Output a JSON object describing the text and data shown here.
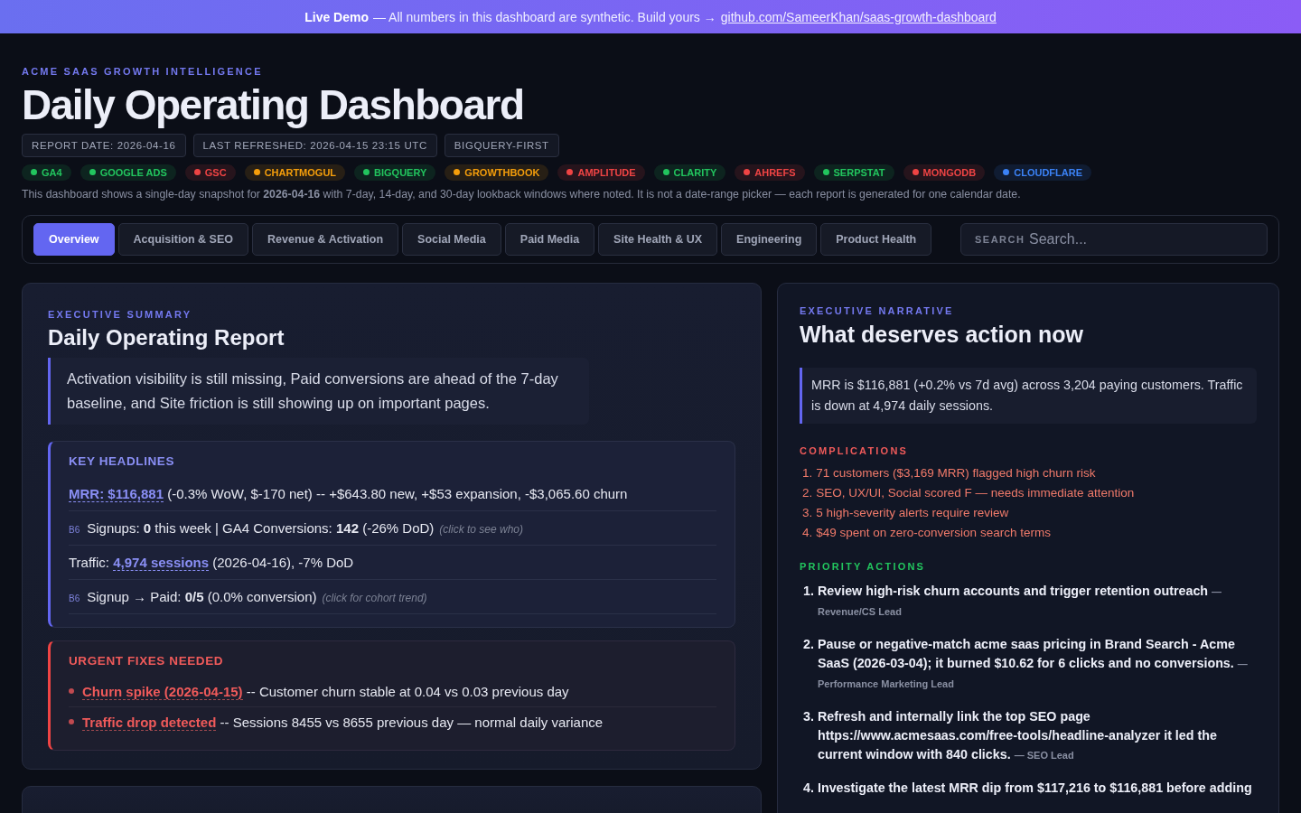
{
  "banner": {
    "label": "Live Demo",
    "text": "— All numbers in this dashboard are synthetic. Build yours →",
    "link": "github.com/SameerKhan/saas-growth-dashboard"
  },
  "header": {
    "eyebrow": "ACME SAAS GROWTH INTELLIGENCE",
    "title": "Daily Operating Dashboard",
    "meta": [
      "REPORT DATE: 2026-04-16",
      "LAST REFRESHED: 2026-04-15 23:15 UTC",
      "BIGQUERY-FIRST"
    ],
    "sources": [
      {
        "label": "GA4",
        "color": "#22c55e"
      },
      {
        "label": "GOOGLE ADS",
        "color": "#22c55e"
      },
      {
        "label": "GSC",
        "color": "#ef4444"
      },
      {
        "label": "CHARTMOGUL",
        "color": "#f59e0b"
      },
      {
        "label": "BIGQUERY",
        "color": "#22c55e"
      },
      {
        "label": "GROWTHBOOK",
        "color": "#f59e0b"
      },
      {
        "label": "AMPLITUDE",
        "color": "#ef4444"
      },
      {
        "label": "CLARITY",
        "color": "#22c55e"
      },
      {
        "label": "AHREFS",
        "color": "#ef4444"
      },
      {
        "label": "SERPSTAT",
        "color": "#22c55e"
      },
      {
        "label": "MONGODB",
        "color": "#ef4444"
      },
      {
        "label": "CLOUDFLARE",
        "color": "#3b82f6"
      }
    ],
    "note": "This dashboard shows a single-day snapshot for **2026-04-16** with 7-day, 14-day, and 30-day lookback windows where noted. It is not a date-range picker — each report is generated for one calendar date."
  },
  "tabs": [
    {
      "label": "Overview",
      "selected": true
    },
    {
      "label": "Acquisition & SEO",
      "selected": false
    },
    {
      "label": "Revenue & Activation",
      "selected": false
    },
    {
      "label": "Social Media",
      "selected": false
    },
    {
      "label": "Paid Media",
      "selected": false
    },
    {
      "label": "Site Health & UX",
      "selected": false
    },
    {
      "label": "Engineering",
      "selected": false
    },
    {
      "label": "Product Health",
      "selected": false
    }
  ],
  "search": {
    "label": "SEARCH",
    "placeholder": "Search..."
  },
  "summary": {
    "eyebrow": "EXECUTIVE SUMMARY",
    "title": "Daily Operating Report",
    "lead": "Activation visibility is still missing, Paid conversions are ahead of the 7-day baseline, and Site friction is still showing up on important pages.",
    "headlines": {
      "title": "KEY HEADLINES",
      "items": [
        {
          "link": "MRR: $116,881",
          "text": "(-0.3% WoW, $-170 net) -- +$643.80 new, +$53 expansion, -$3,065.60 churn"
        },
        {
          "badge": "B6",
          "text": "Signups: **0** this week | GA4 Conversions: **142** (-26% DoD)",
          "hint": "(click to see who)"
        },
        {
          "prefix": "Traffic:",
          "link": "4,974 sessions",
          "text": "(2026-04-16), -7% DoD"
        },
        {
          "badge": "B6",
          "text": "Signup → Paid: **0/5** (0.0% conversion)",
          "hint": "(click for cohort trend)"
        }
      ]
    },
    "urgent": {
      "title": "URGENT FIXES NEEDED",
      "items": [
        {
          "link": "Churn spike (2026-04-15)",
          "text": "-- Customer churn stable at 0.04 vs 0.03 previous day"
        },
        {
          "link": "Traffic drop detected",
          "text": "-- Sessions 8455 vs 8655 previous day — normal daily variance"
        }
      ]
    }
  },
  "narrative": {
    "eyebrow": "EXECUTIVE NARRATIVE",
    "title": "What deserves action now",
    "situation": "MRR is $116,881 (+0.2% vs 7d avg) across 3,204 paying customers. Traffic is down at 4,974 daily sessions.",
    "complications": {
      "title": "COMPLICATIONS",
      "items": [
        {
          "num": "1.",
          "text": "71 customers ($3,169 MRR) flagged high churn risk"
        },
        {
          "num": "2.",
          "text": "SEO, UX/UI, Social scored F — needs immediate attention"
        },
        {
          "num": "3.",
          "text": "5 high-severity alerts require review"
        },
        {
          "num": "4.",
          "text": "$49 spent on zero-conversion search terms"
        }
      ]
    },
    "actions": {
      "title": "PRIORITY ACTIONS",
      "items": [
        {
          "num": "1.",
          "text": "Review high-risk churn accounts and trigger retention outreach",
          "owner": "— Revenue/CS Lead"
        },
        {
          "num": "2.",
          "text": "Pause or negative-match acme saas pricing in Brand Search - Acme SaaS (2026-03-04); it burned $10.62 for 6 clicks and no conversions.",
          "owner": "— Performance Marketing Lead"
        },
        {
          "num": "3.",
          "text": "Refresh and internally link the top SEO page https://www.acmesaas.com/free-tools/headline-analyzer it led the current window with 840 clicks.",
          "owner": "— SEO Lead"
        },
        {
          "num": "4.",
          "text": "Investigate the latest MRR dip from $117,216 to $116,881 before adding"
        }
      ]
    }
  }
}
